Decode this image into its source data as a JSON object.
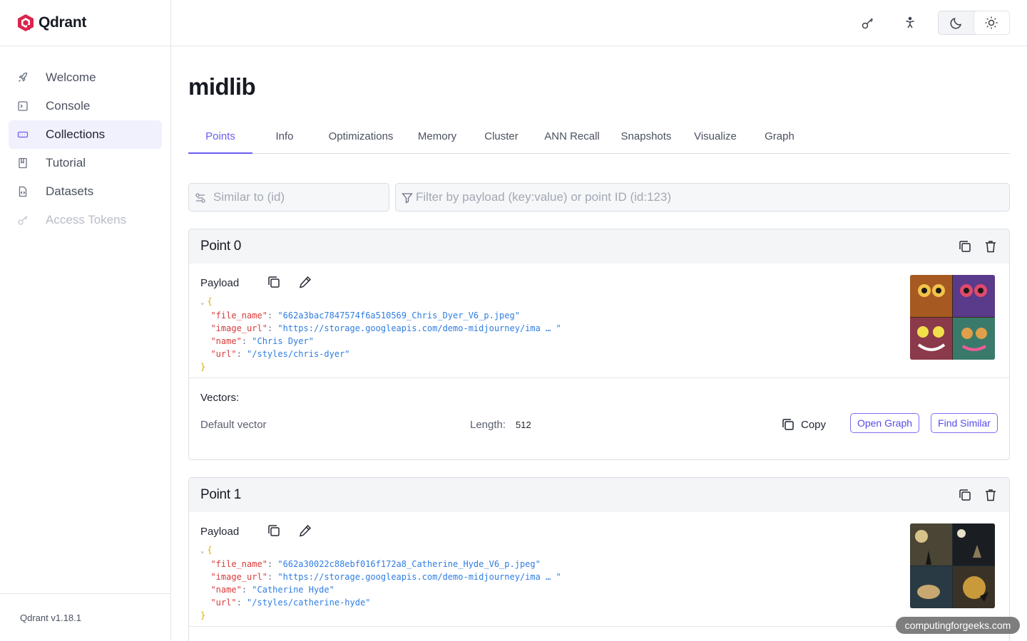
{
  "app": {
    "name": "Qdrant",
    "version": "Qdrant v1.18.1"
  },
  "sidebar": {
    "items": [
      {
        "label": "Welcome",
        "icon": "rocket-icon"
      },
      {
        "label": "Console",
        "icon": "terminal-icon"
      },
      {
        "label": "Collections",
        "icon": "collections-icon",
        "active": true
      },
      {
        "label": "Tutorial",
        "icon": "book-icon"
      },
      {
        "label": "Datasets",
        "icon": "file-code-icon"
      },
      {
        "label": "Access Tokens",
        "icon": "key-icon",
        "disabled": true
      }
    ]
  },
  "topbar": {
    "icons": [
      "key-icon",
      "accessibility-icon",
      "moon-icon",
      "sun-icon"
    ],
    "theme": "light"
  },
  "page": {
    "title": "midlib"
  },
  "tabs": [
    "Points",
    "Info",
    "Optimizations",
    "Memory",
    "Cluster",
    "ANN Recall",
    "Snapshots",
    "Visualize",
    "Graph"
  ],
  "active_tab": "Points",
  "search": {
    "similar_placeholder": "Similar to (id)",
    "filter_placeholder": "Filter by payload (key:value) or point ID (id:123)"
  },
  "points": [
    {
      "title": "Point 0",
      "payload_label": "Payload",
      "payload": [
        {
          "key": "\"file_name\"",
          "value": "\"662a3bac7847574f6a510569_Chris_Dyer_V6_p.jpeg\""
        },
        {
          "key": "\"image_url\"",
          "value": "\"https://storage.googleapis.com/demo-midjourney/ima … \""
        },
        {
          "key": "\"name\"",
          "value": "\"Chris Dyer\""
        },
        {
          "key": "\"url\"",
          "value": "\"/styles/chris-dyer\""
        }
      ],
      "vectors_label": "Vectors:",
      "vector_name": "Default vector",
      "length_label": "Length:",
      "length": "512",
      "copy_label": "Copy",
      "open_graph_label": "Open Graph",
      "find_similar_label": "Find Similar"
    },
    {
      "title": "Point 1",
      "payload_label": "Payload",
      "payload": [
        {
          "key": "\"file_name\"",
          "value": "\"662a30022c88ebf016f172a8_Catherine_Hyde_V6_p.jpeg\""
        },
        {
          "key": "\"image_url\"",
          "value": "\"https://storage.googleapis.com/demo-midjourney/ima … \""
        },
        {
          "key": "\"name\"",
          "value": "\"Catherine Hyde\""
        },
        {
          "key": "\"url\"",
          "value": "\"/styles/catherine-hyde\""
        }
      ]
    }
  ],
  "watermark": "computingforgeeks.com",
  "colors": {
    "accent": "#6a5cf0",
    "key": "#d83a3a",
    "string": "#2f7de1",
    "brace": "#d9b100"
  }
}
